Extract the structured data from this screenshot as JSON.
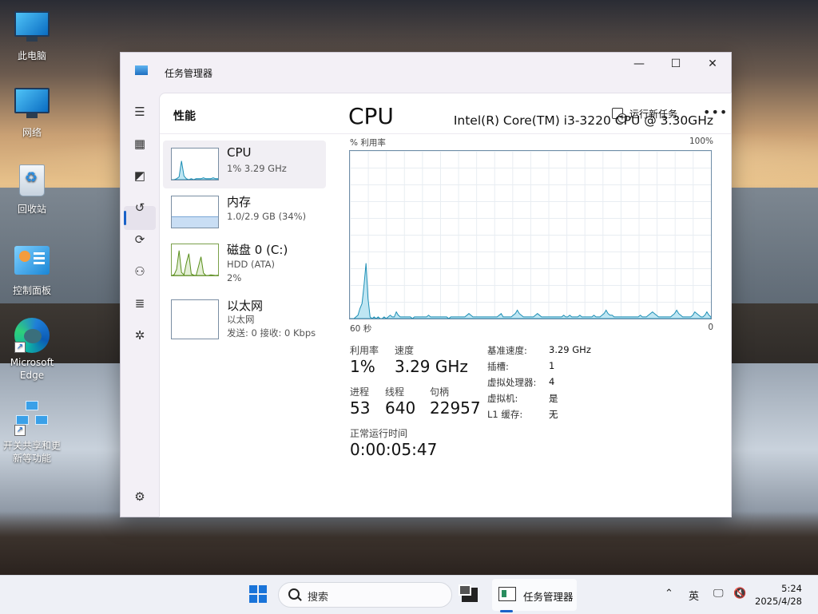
{
  "desktop": {
    "icons": [
      {
        "label": "此电脑"
      },
      {
        "label": "网络"
      },
      {
        "label": "回收站"
      },
      {
        "label": "控制面板"
      },
      {
        "label_line1": "Microsoft",
        "label_line2": "Edge"
      },
      {
        "label_line1": "开关共享和更",
        "label_line2": "新等功能"
      }
    ]
  },
  "window": {
    "title": "任务管理器",
    "controls": {
      "minimize": "—",
      "maximize": "☐",
      "close": "✕"
    }
  },
  "nav": {
    "items": [
      {
        "icon": "hamburger-icon",
        "glyph": "☰"
      },
      {
        "icon": "processes-icon",
        "glyph": "▦"
      },
      {
        "icon": "performance-icon",
        "glyph": "◩"
      },
      {
        "icon": "app-history-icon",
        "glyph": "↺"
      },
      {
        "icon": "startup-apps-icon",
        "glyph": "⟳"
      },
      {
        "icon": "users-icon",
        "glyph": "⚇"
      },
      {
        "icon": "details-icon",
        "glyph": "≣"
      },
      {
        "icon": "services-icon",
        "glyph": "✲"
      },
      {
        "icon": "settings-icon",
        "glyph": "⚙"
      }
    ]
  },
  "header": {
    "title": "性能",
    "run_new_task": "运行新任务",
    "more": "•••"
  },
  "perf_list": [
    {
      "name": "CPU",
      "sub1": "1% 3.29 GHz",
      "sub2": ""
    },
    {
      "name": "内存",
      "sub1": "1.0/2.9 GB (34%)",
      "sub2": ""
    },
    {
      "name": "磁盘 0 (C:)",
      "sub1": "HDD (ATA)",
      "sub2": "2%"
    },
    {
      "name": "以太网",
      "sub1": "以太网",
      "sub2": "发送: 0 接收: 0 Kbps"
    }
  ],
  "detail": {
    "title": "CPU",
    "model": "Intel(R) Core(TM) i3-3220 CPU @ 3.30GHz",
    "graph_label": "% 利用率",
    "graph_max": "100%",
    "graph_left": "60 秒",
    "graph_right": "0",
    "stats": {
      "util_label": "利用率",
      "util_value": "1%",
      "speed_label": "速度",
      "speed_value": "3.29 GHz",
      "proc_label": "进程",
      "proc_value": "53",
      "threads_label": "线程",
      "threads_value": "640",
      "handles_label": "句柄",
      "handles_value": "22957",
      "uptime_label": "正常运行时间",
      "uptime_value": "0:00:05:47"
    },
    "specs": [
      {
        "k": "基准速度:",
        "v": "3.29 GHz"
      },
      {
        "k": "插槽:",
        "v": "1"
      },
      {
        "k": "虚拟处理器:",
        "v": "4"
      },
      {
        "k": "虚拟机:",
        "v": "是"
      },
      {
        "k": "L1 缓存:",
        "v": "无"
      }
    ],
    "cpu_history_pct": [
      0,
      0,
      0,
      1,
      2,
      6,
      9,
      20,
      33,
      12,
      1,
      0,
      1,
      0,
      1,
      0,
      0,
      1,
      0,
      1,
      2,
      1,
      1,
      4,
      2,
      1,
      1,
      1,
      1,
      1,
      1,
      0,
      1,
      1,
      1,
      1,
      1,
      1,
      1,
      2,
      1,
      1,
      1,
      1,
      1,
      1,
      1,
      1,
      1,
      0,
      1,
      1,
      1,
      1,
      1,
      1,
      1,
      1,
      2,
      3,
      2,
      1,
      1,
      1,
      1,
      1,
      1,
      1,
      1,
      1,
      1,
      1,
      1,
      1,
      2,
      3,
      1,
      1,
      1,
      1,
      1,
      2,
      3,
      5,
      3,
      2,
      1,
      1,
      1,
      1,
      1,
      1,
      2,
      3,
      2,
      1,
      1,
      1,
      1,
      1,
      1,
      1,
      1,
      1,
      1,
      1,
      2,
      1,
      1,
      2,
      1,
      1,
      1,
      1,
      2,
      1,
      1,
      1,
      1,
      1,
      1,
      2,
      1,
      1,
      1,
      2,
      3,
      5,
      3,
      2,
      2,
      1,
      1,
      1,
      1,
      1,
      1,
      1,
      1,
      1,
      1,
      1,
      1,
      1,
      2,
      1,
      1,
      1,
      2,
      3,
      4,
      3,
      2,
      1,
      1,
      1,
      1,
      1,
      1,
      1,
      2,
      3,
      5,
      3,
      2,
      1,
      1,
      1,
      1,
      1,
      2,
      4,
      3,
      2,
      1,
      1,
      2,
      4,
      2,
      1
    ],
    "thumbs": {
      "cpu": [
        0,
        0,
        1,
        3,
        20,
        4,
        1,
        0,
        1,
        0,
        1,
        1,
        1,
        2,
        1,
        1,
        1,
        2,
        1,
        1
      ],
      "memory_pct": 34,
      "disk": [
        0,
        3,
        20,
        80,
        10,
        2,
        40,
        70,
        5,
        1,
        0,
        30,
        60,
        8,
        0,
        0,
        2,
        1,
        0,
        1
      ]
    }
  },
  "taskbar": {
    "search_placeholder": "搜索",
    "active_app": "任务管理器",
    "tray_chevron": "⌃",
    "ime": "英",
    "time": "5:24",
    "date": "2025/4/28"
  },
  "colors": {
    "accent": "#1a62c8",
    "cpu_line": "#1e8fb5",
    "cpu_fill": "#bfe6f3",
    "memory_fill": "#c9def4",
    "disk_line": "#5a8f1c"
  }
}
